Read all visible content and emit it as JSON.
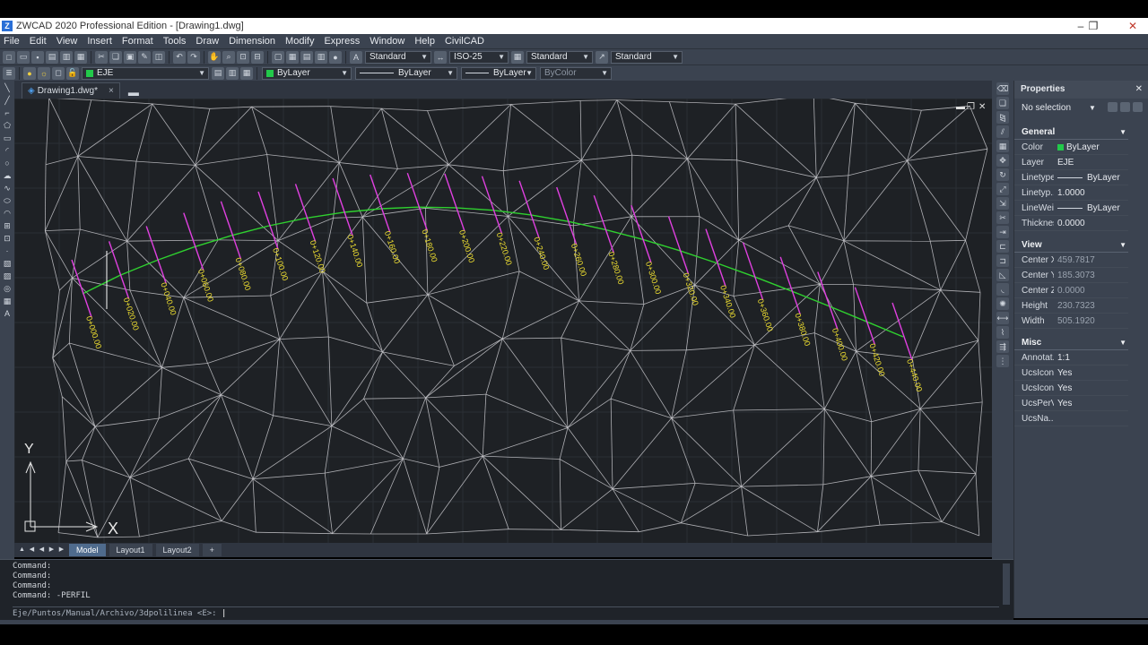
{
  "window": {
    "title": "ZWCAD 2020 Professional Edition - [Drawing1.dwg]"
  },
  "menu": [
    "File",
    "Edit",
    "View",
    "Insert",
    "Format",
    "Tools",
    "Draw",
    "Dimension",
    "Modify",
    "Express",
    "Window",
    "Help",
    "CivilCAD"
  ],
  "toolbar": {
    "text_style": "Standard",
    "dim_style": "ISO-25",
    "table_style": "Standard",
    "mleader_style": "Standard",
    "layer": "EJE",
    "color": "ByLayer",
    "linetype": "ByLayer",
    "lineweight": "ByLayer",
    "plot_style": "ByColor"
  },
  "doc_tab": {
    "label": "Drawing1.dwg*",
    "close": "×"
  },
  "canvas": {
    "bg": "#1e2125",
    "mesh_color": "#c8c8cc",
    "alignment_color": "#2fd02f",
    "tick_color": "#e040e0",
    "label_color": "#f0e030",
    "ucs_y": "Y",
    "ucs_x": "X",
    "stations": [
      "0+000.00",
      "0+020.00",
      "0+040.00",
      "0+060.00",
      "0+080.00",
      "0+100.00",
      "0+120.00",
      "0+140.00",
      "0+160.00",
      "0+180.00",
      "0+200.00",
      "0+220.00",
      "0+240.00",
      "0+260.00",
      "0+280.00",
      "0+300.00",
      "0+320.00",
      "0+340.00",
      "0+360.00",
      "0+380.00",
      "0+400.00",
      "0+420.00",
      "0+440.00"
    ]
  },
  "properties": {
    "title": "Properties",
    "selection": "No selection",
    "general": {
      "header": "General",
      "rows": [
        {
          "key": "Color",
          "value": "ByLayer"
        },
        {
          "key": "Layer",
          "value": "EJE"
        },
        {
          "key": "Linetype",
          "value": "ByLayer"
        },
        {
          "key": "Linetyp...",
          "value": "1.0000"
        },
        {
          "key": "LineWei...",
          "value": "ByLayer"
        },
        {
          "key": "Thickness",
          "value": "0.0000"
        }
      ]
    },
    "view": {
      "header": "View",
      "rows": [
        {
          "key": "Center X",
          "value": "459.7817"
        },
        {
          "key": "Center Y",
          "value": "185.3073"
        },
        {
          "key": "Center Z",
          "value": "0.0000"
        },
        {
          "key": "Height",
          "value": "230.7323"
        },
        {
          "key": "Width",
          "value": "505.1920"
        }
      ]
    },
    "misc": {
      "header": "Misc",
      "rows": [
        {
          "key": "Annotat...",
          "value": "1:1"
        },
        {
          "key": "UcsIcon...",
          "value": "Yes"
        },
        {
          "key": "UcsIcon...",
          "value": "Yes"
        },
        {
          "key": "UcsPerV...",
          "value": "Yes"
        },
        {
          "key": "UcsNa...",
          "value": ""
        }
      ]
    }
  },
  "layout_tabs": [
    "Model",
    "Layout1",
    "Layout2",
    "+"
  ],
  "command": {
    "history": [
      "Command:",
      "Command:",
      "Command:",
      "Command: -PERFIL"
    ],
    "prompt": "Eje/Puntos/Manual/Archivo/3dpolilinea <E>:"
  }
}
